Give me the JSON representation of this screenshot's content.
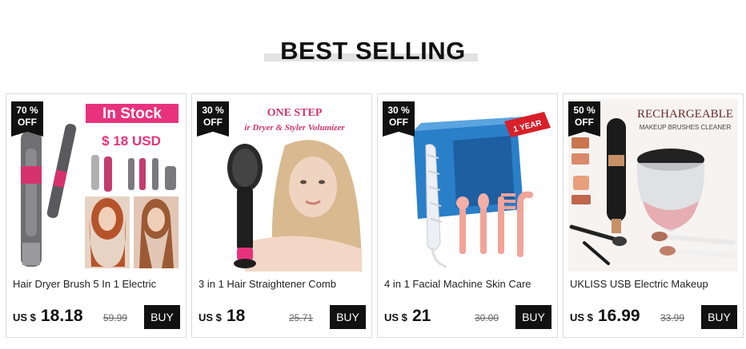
{
  "section": {
    "heading": "BEST SELLING"
  },
  "colors": {
    "accent": "#e8327d",
    "badge": "#111111",
    "button": "#111111"
  },
  "products": [
    {
      "discount": "70 %",
      "off": "OFF",
      "image_text": {
        "stock": "In Stock",
        "price": "$ 18 USD"
      },
      "title": "Hair Dryer Brush 5 In 1 Electric",
      "currency": "US $",
      "price": "18.18",
      "old_price": "59.99",
      "buy": "BUY"
    },
    {
      "discount": "30 %",
      "off": "OFF",
      "image_text": {
        "line1": "ONE STEP",
        "line2": "ir Dryer & Styler Volumizer"
      },
      "title": "3 in 1 Hair Straightener Comb",
      "currency": "US $",
      "price": "18",
      "old_price": "25.71",
      "buy": "BUY"
    },
    {
      "discount": "30 %",
      "off": "OFF",
      "image_text": {
        "ribbon": "1 YEAR"
      },
      "title": "4 in 1 Facial Machine Skin Care",
      "currency": "US $",
      "price": "21",
      "old_price": "30.00",
      "buy": "BUY"
    },
    {
      "discount": "50 %",
      "off": "OFF",
      "image_text": {
        "line1": "RECHARGEABLE",
        "line2": "MAKEUP BRUSHES CLEANER"
      },
      "title": "UKLISS USB Electric Makeup",
      "currency": "US $",
      "price": "16.99",
      "old_price": "33.99",
      "buy": "BUY"
    }
  ]
}
